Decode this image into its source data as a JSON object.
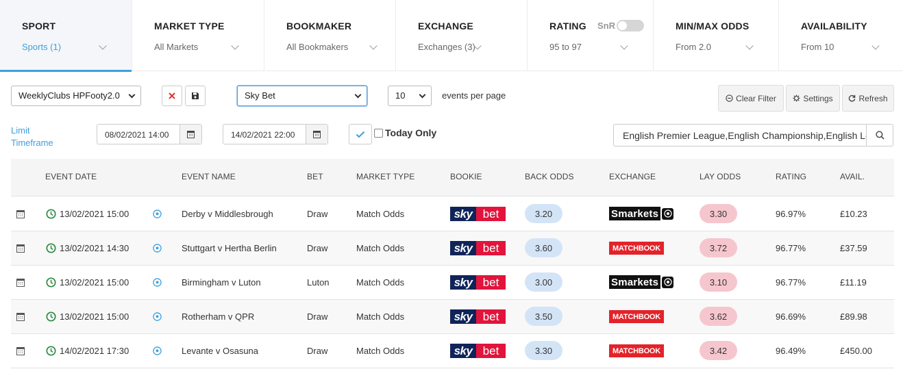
{
  "filters": [
    {
      "title": "SPORT",
      "value": "Sports (1)",
      "active": true
    },
    {
      "title": "MARKET TYPE",
      "value": "All Markets"
    },
    {
      "title": "BOOKMAKER",
      "value": "All Bookmakers"
    },
    {
      "title": "EXCHANGE",
      "value": "Exchanges (3)"
    },
    {
      "title": "RATING",
      "value": "95 to 97",
      "toggle_label": "SnR"
    },
    {
      "title": "MIN/MAX ODDS",
      "value": "From 2.0"
    },
    {
      "title": "AVAILABILITY",
      "value": "From 10"
    }
  ],
  "toolbar": {
    "preset_select": "WeeklyClubs HPFooty2.0",
    "bookmaker_select": "Sky Bet",
    "per_page_select": "10",
    "per_page_label": "events per page",
    "clear_filter": "Clear Filter",
    "settings": "Settings",
    "refresh": "Refresh"
  },
  "timeframe": {
    "label_line1": "Limit",
    "label_line2": "Timeframe",
    "from": "08/02/2021 14:00",
    "to": "14/02/2021 22:00",
    "today_only": "Today Only",
    "leagues": "English Premier League,English Championship,English League One"
  },
  "table": {
    "headers": {
      "event_date": "EVENT DATE",
      "event_name": "EVENT NAME",
      "bet": "BET",
      "market_type": "MARKET TYPE",
      "bookie": "BOOKIE",
      "back_odds": "BACK ODDS",
      "exchange": "EXCHANGE",
      "lay_odds": "LAY ODDS",
      "rating": "RATING",
      "avail": "AVAIL."
    },
    "rows": [
      {
        "date": "13/02/2021 15:00",
        "event": "Derby v Middlesbrough",
        "bet": "Draw",
        "market": "Match Odds",
        "back": "3.20",
        "exchange": "smarkets",
        "lay": "3.30",
        "rating": "96.97%",
        "avail": "£10.23"
      },
      {
        "date": "13/02/2021 14:30",
        "event": "Stuttgart v Hertha Berlin",
        "bet": "Draw",
        "market": "Match Odds",
        "back": "3.60",
        "exchange": "matchbook",
        "lay": "3.72",
        "rating": "96.77%",
        "avail": "£37.59"
      },
      {
        "date": "13/02/2021 15:00",
        "event": "Birmingham v Luton",
        "bet": "Luton",
        "market": "Match Odds",
        "back": "3.00",
        "exchange": "smarkets",
        "lay": "3.10",
        "rating": "96.77%",
        "avail": "£11.19"
      },
      {
        "date": "13/02/2021 15:00",
        "event": "Rotherham v QPR",
        "bet": "Draw",
        "market": "Match Odds",
        "back": "3.50",
        "exchange": "matchbook",
        "lay": "3.62",
        "rating": "96.69%",
        "avail": "£89.98"
      },
      {
        "date": "14/02/2021 17:30",
        "event": "Levante v Osasuna",
        "bet": "Draw",
        "market": "Match Odds",
        "back": "3.30",
        "exchange": "matchbook",
        "lay": "3.42",
        "rating": "96.49%",
        "avail": "£450.00"
      }
    ]
  },
  "logos": {
    "skybet_sky": "sky",
    "skybet_bet": "bet",
    "smarkets": "Smarkets",
    "matchbook": "MATCHBOOK"
  },
  "colors": {
    "accent": "#3d9fdd",
    "back_pill": "#d4e4f7",
    "lay_pill": "#f6c6ce",
    "clock_green": "#2a8a3e"
  }
}
